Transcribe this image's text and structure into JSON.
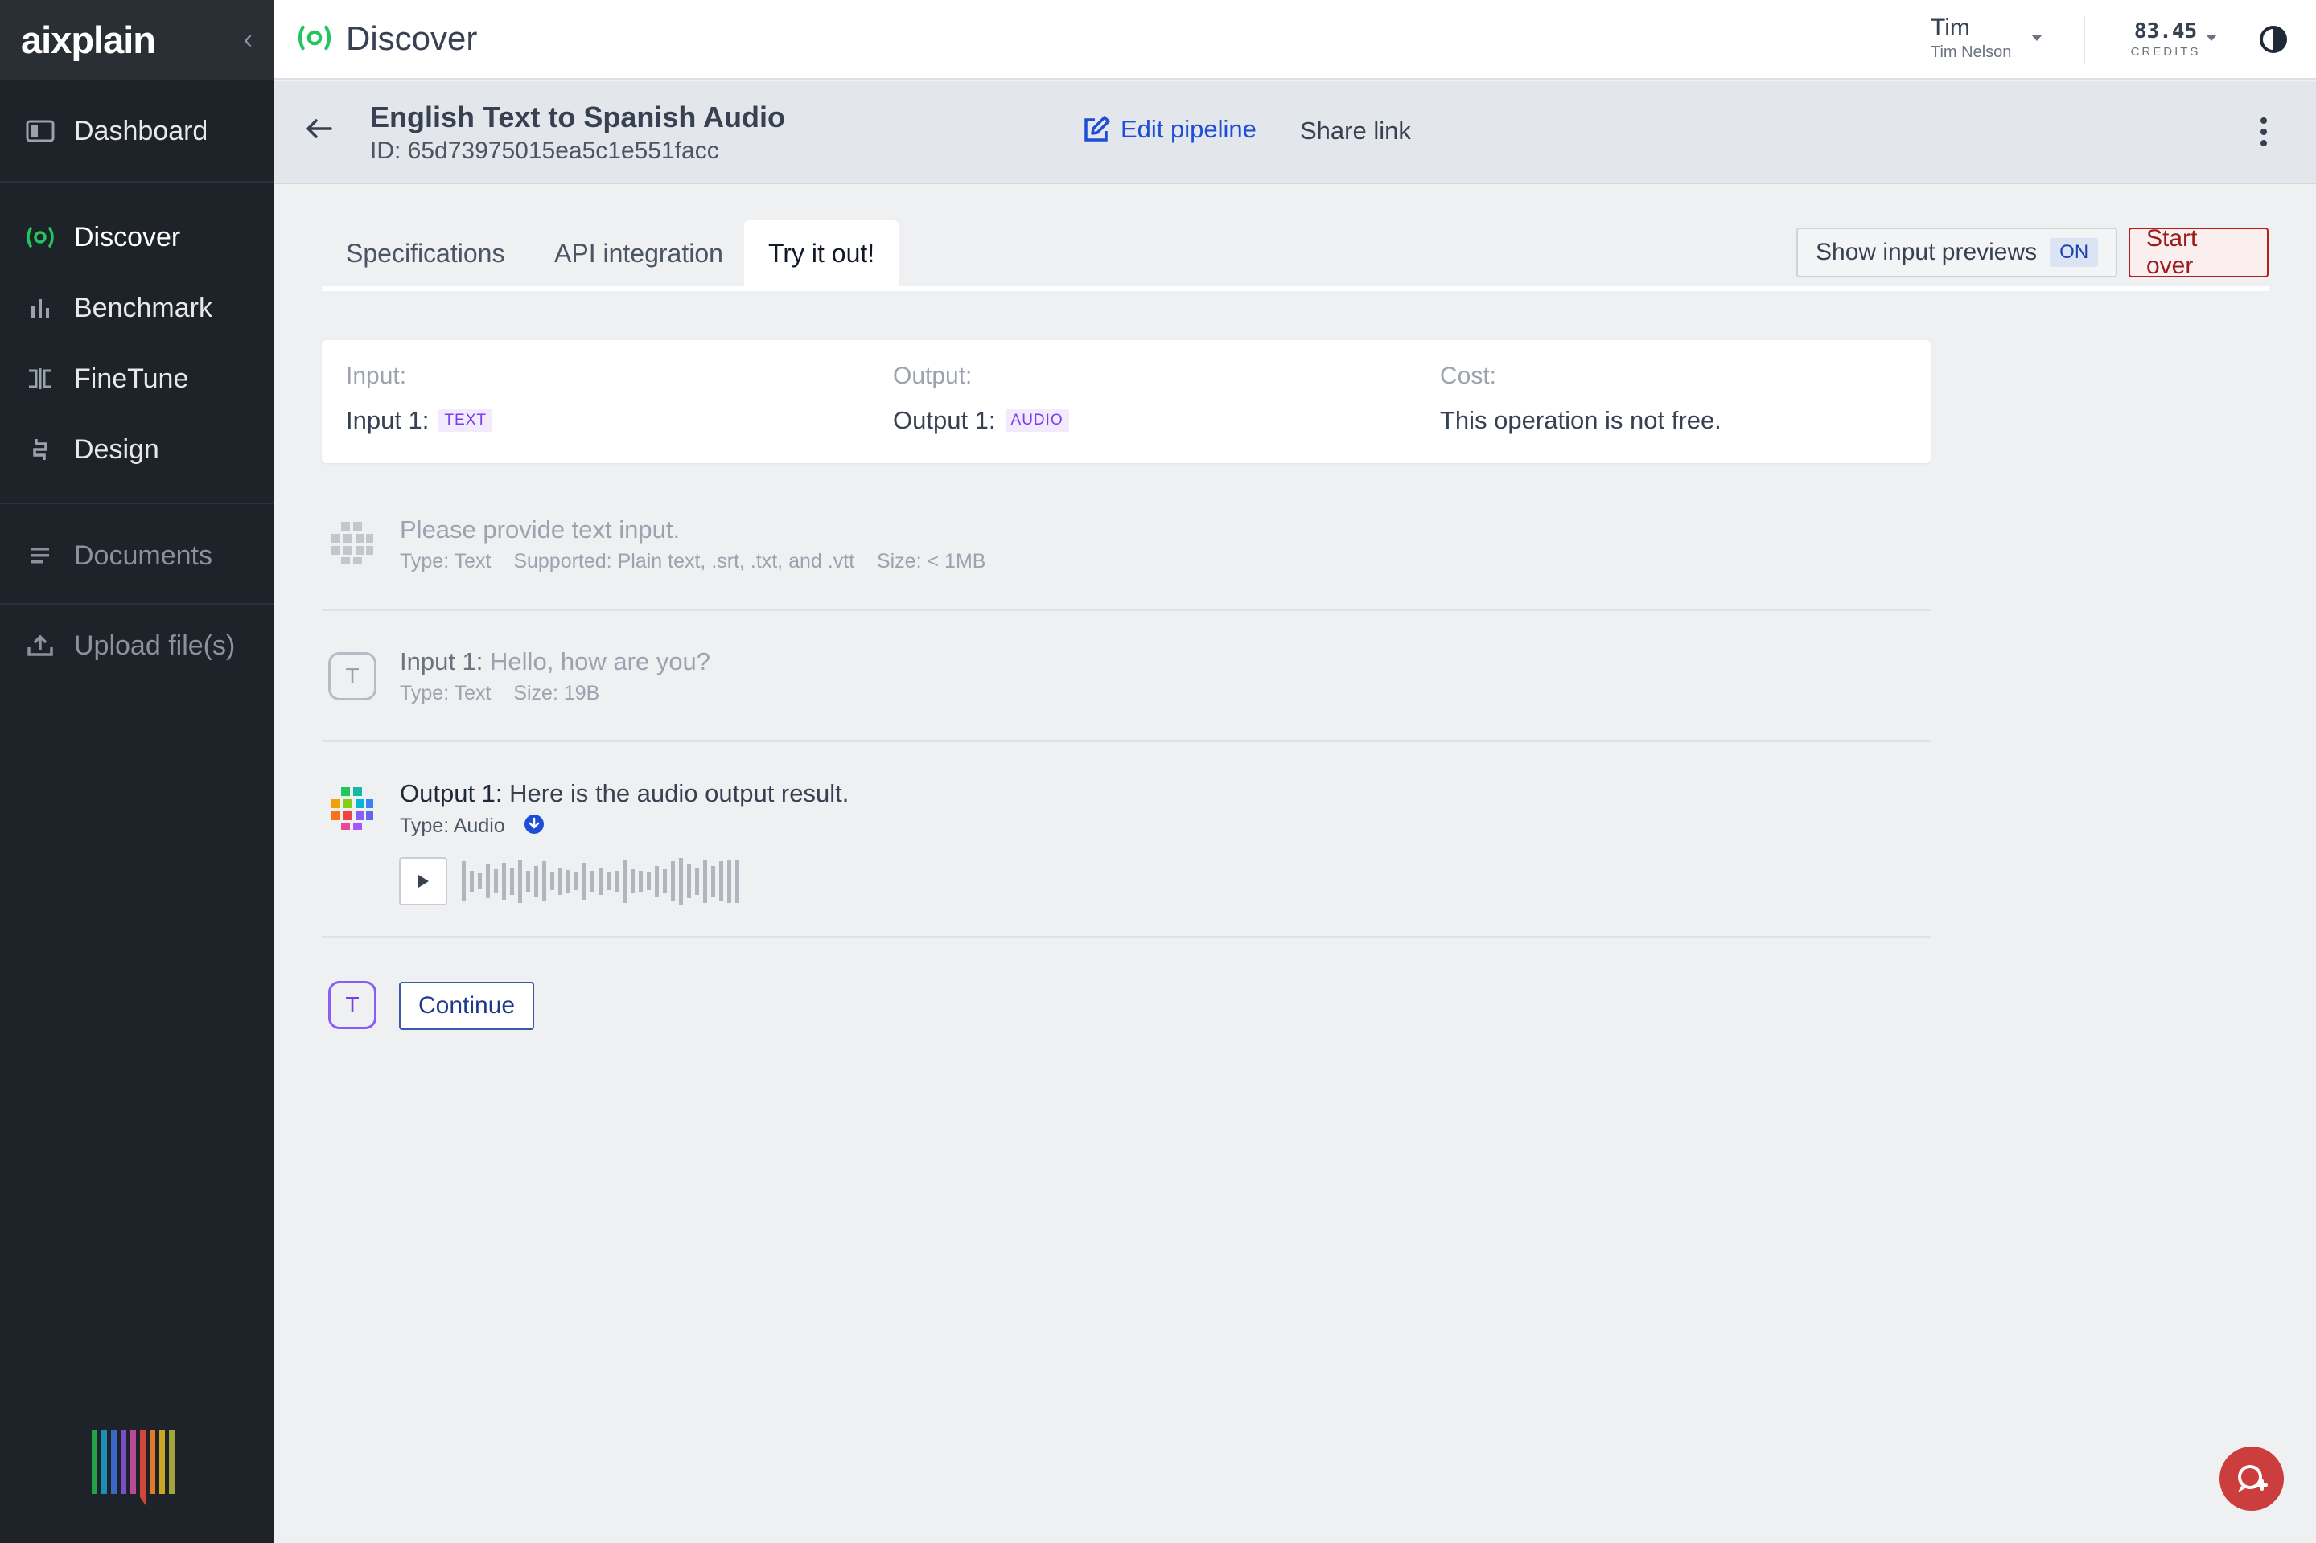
{
  "app": {
    "logo": "aixplain",
    "page_title": "Discover"
  },
  "sidebar": {
    "items": [
      {
        "label": "Dashboard",
        "icon": "dashboard-icon"
      },
      {
        "label": "Discover",
        "icon": "discover-icon",
        "active": true
      },
      {
        "label": "Benchmark",
        "icon": "benchmark-icon"
      },
      {
        "label": "FineTune",
        "icon": "finetune-icon"
      },
      {
        "label": "Design",
        "icon": "design-icon"
      },
      {
        "label": "Documents",
        "icon": "documents-icon"
      },
      {
        "label": "Upload file(s)",
        "icon": "upload-icon"
      }
    ]
  },
  "user": {
    "name": "Tim",
    "full_name": "Tim Nelson"
  },
  "credits": {
    "amount": "83.45",
    "label": "CREDITS"
  },
  "pipeline": {
    "title": "English Text to Spanish Audio",
    "id": "ID: 65d73975015ea5c1e551facc",
    "edit_label": "Edit pipeline",
    "share_label": "Share link"
  },
  "tabs": [
    {
      "label": "Specifications"
    },
    {
      "label": "API integration"
    },
    {
      "label": "Try it out!",
      "active": true
    }
  ],
  "controls": {
    "previews_label": "Show input previews",
    "previews_state": "ON",
    "start_over": "Start over"
  },
  "info": {
    "input_label": "Input:",
    "input_value": "Input 1:",
    "input_type": "TEXT",
    "output_label": "Output:",
    "output_value": "Output 1:",
    "output_type": "AUDIO",
    "cost_label": "Cost:",
    "cost_value": "This operation is not free."
  },
  "messages": {
    "prompt": {
      "text": "Please provide text input.",
      "type_key": "Type:",
      "type_val": "Text",
      "supported_key": "Supported:",
      "supported_val": "Plain text, .srt, .txt, and .vtt",
      "size_key": "Size:",
      "size_val": "< 1MB"
    },
    "input": {
      "badge": "T",
      "label": "Input 1:",
      "text": "Hello, how are you?",
      "type_key": "Type:",
      "type_val": "Text",
      "size_key": "Size:",
      "size_val": "19B"
    },
    "output": {
      "label": "Output 1:",
      "text": "Here is the audio output result.",
      "type_key": "Type:",
      "type_val": "Audio"
    },
    "continue": {
      "badge": "T",
      "button": "Continue"
    }
  },
  "colors": {
    "sidebar_bg": "#1e2329",
    "accent_green": "#22c55e",
    "link_blue": "#1d4ed8",
    "danger_red": "#b91c1c",
    "tag_purple": "#7c3aed"
  }
}
